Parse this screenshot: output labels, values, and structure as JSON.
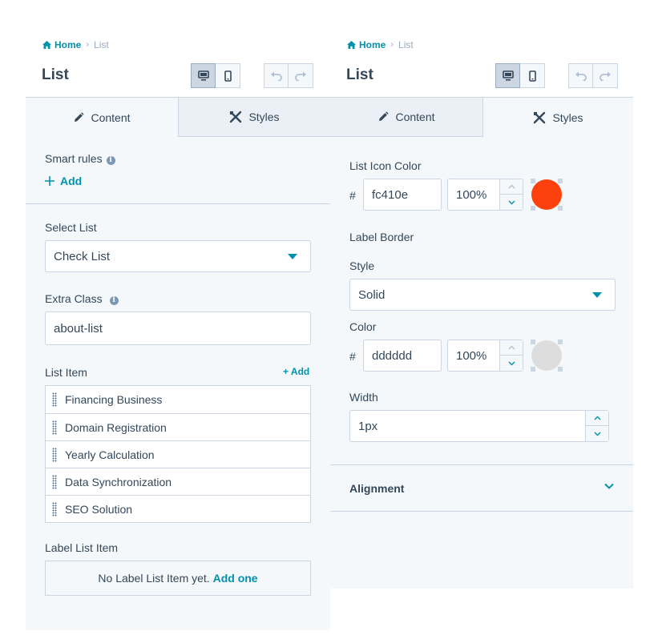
{
  "left": {
    "breadcrumb": {
      "home": "Home",
      "current": "List"
    },
    "title": "List",
    "tabs": {
      "content": "Content",
      "styles": "Styles"
    },
    "smart_rules": {
      "label": "Smart rules",
      "add": "Add"
    },
    "select_list": {
      "label": "Select List",
      "value": "Check List"
    },
    "extra_class": {
      "label": "Extra Class",
      "value": "about-list"
    },
    "list_item": {
      "label": "List Item",
      "add": "+ Add",
      "items": [
        "Financing Business",
        "Domain Registration",
        "Yearly Calculation",
        "Data Synchronization",
        "SEO Solution"
      ]
    },
    "label_list_item": {
      "label": "Label List Item",
      "empty_text": "No Label List Item yet.",
      "add_one": "Add one"
    }
  },
  "right": {
    "breadcrumb": {
      "home": "Home",
      "current": "List"
    },
    "title": "List",
    "tabs": {
      "content": "Content",
      "styles": "Styles"
    },
    "list_icon_color": {
      "label": "List Icon Color",
      "hash": "#",
      "hex": "fc410e",
      "opacity": "100%",
      "swatch": "#fc410e"
    },
    "label_border": {
      "label": "Label Border",
      "style_label": "Style",
      "style_value": "Solid",
      "color_label": "Color",
      "hash": "#",
      "hex": "dddddd",
      "opacity": "100%",
      "swatch": "#dddddd",
      "width_label": "Width",
      "width_value": "1px"
    },
    "alignment": {
      "label": "Alignment"
    }
  },
  "colors": {
    "accent": "#0091ae",
    "text": "#33475b",
    "border": "#cbd6e2",
    "panel_bg": "#f5f8fa"
  }
}
